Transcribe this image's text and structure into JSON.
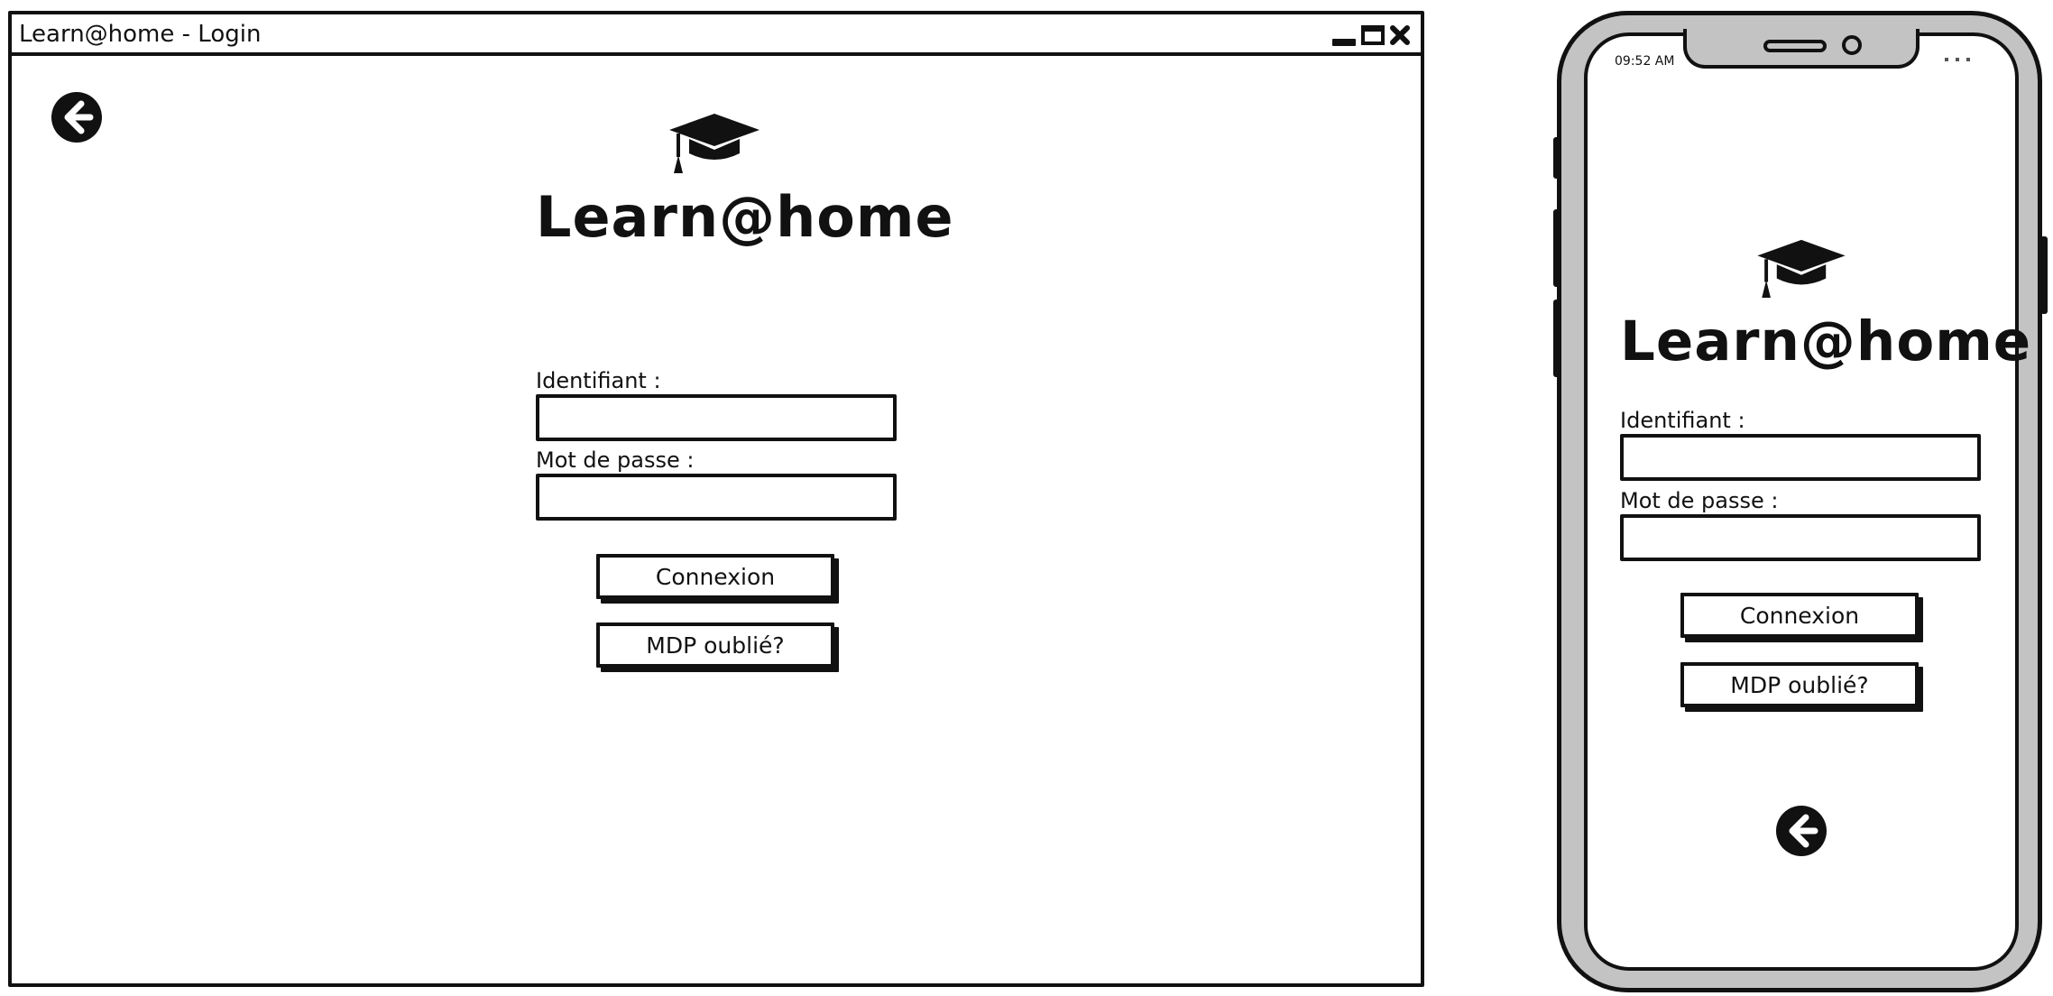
{
  "desktop": {
    "window_title": "Learn@home - Login",
    "controls": {
      "minimize": "minimize-icon",
      "maximize": "maximize-icon",
      "close": "close-icon"
    },
    "back_icon": "arrow-left-circle-icon",
    "logo": {
      "icon": "graduation-cap-icon",
      "text": "Learn@home"
    },
    "form": {
      "username_label": "Identifiant :",
      "username_value": "",
      "password_label": "Mot de passe :",
      "password_value": "",
      "login_button": "Connexion",
      "forgot_button": "MDP oublié?"
    }
  },
  "mobile": {
    "status_time": "09:52 AM",
    "logo": {
      "icon": "graduation-cap-icon",
      "text": "Learn@home"
    },
    "form": {
      "username_label": "Identifiant :",
      "username_value": "",
      "password_label": "Mot de passe :",
      "password_value": "",
      "login_button": "Connexion",
      "forgot_button": "MDP oublié?"
    },
    "back_icon": "arrow-left-circle-icon"
  },
  "colors": {
    "ink": "#111111",
    "phone_frame": "#c3c3c3",
    "background": "#ffffff"
  }
}
